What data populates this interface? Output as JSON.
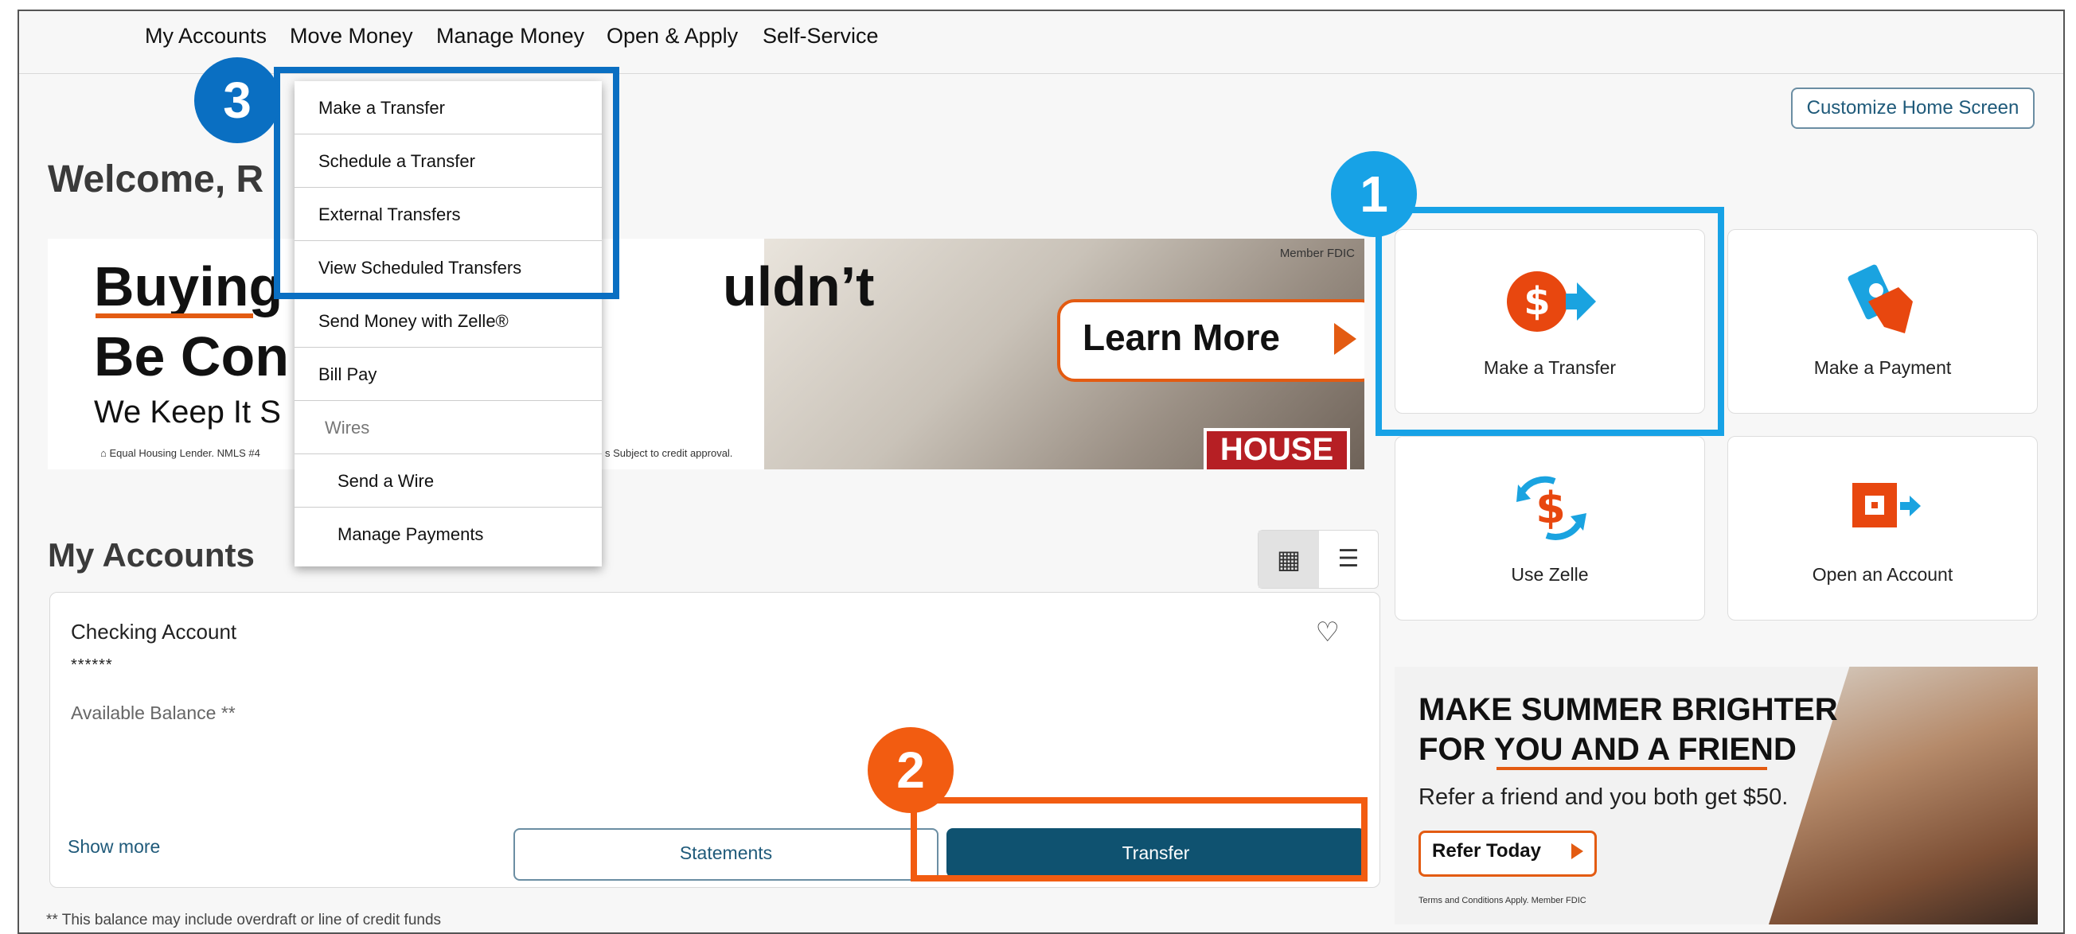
{
  "nav": {
    "items": [
      "My Accounts",
      "Move Money",
      "Manage Money",
      "Open & Apply",
      "Self-Service"
    ]
  },
  "header": {
    "customize_label": "Customize Home Screen",
    "welcome": "Welcome, R"
  },
  "banner": {
    "line1_left": "Buying",
    "line1_right": "uldn’t",
    "line2": "Be Con",
    "sub": "We Keep It S",
    "fine_left": "Equal Housing Lender. NMLS #4",
    "fine_right": "s Subject to credit approval.",
    "member_fdic": "Member FDIC",
    "cta": "Learn More",
    "sign": "HOUSE"
  },
  "dropdown": {
    "items": [
      "Make a Transfer",
      "Schedule a Transfer",
      "External Transfers",
      "View Scheduled Transfers",
      "Send Money with Zelle®",
      "Bill Pay",
      "Wires",
      "Send a Wire",
      "Manage Payments"
    ]
  },
  "accounts": {
    "heading": "My Accounts",
    "card": {
      "name": "Checking Account",
      "mask": "******",
      "balance_label": "Available Balance **",
      "show_more": "Show more",
      "statements": "Statements",
      "transfer": "Transfer"
    },
    "footnote": "** This balance may include overdraft or line of credit funds"
  },
  "tiles": [
    {
      "label": "Make a Transfer",
      "icon": "dollar-arrow-icon"
    },
    {
      "label": "Make a Payment",
      "icon": "hand-money-icon"
    },
    {
      "label": "Use Zelle",
      "icon": "zelle-dollar-icon"
    },
    {
      "label": "Open an Account",
      "icon": "open-account-icon"
    }
  ],
  "promo": {
    "line1": "MAKE SUMMER BRIGHTER",
    "line2": "FOR YOU AND A FRIEND",
    "sub": "Refer a friend and you both get $50.",
    "cta": "Refer Today",
    "fine": "Terms and Conditions Apply. Member FDIC"
  },
  "callouts": {
    "one": "1",
    "two": "2",
    "three": "3"
  },
  "colors": {
    "brand_teal": "#0f5270",
    "accent_orange": "#e35b12",
    "callout_blue": "#17a2e6",
    "callout_dark_blue": "#0a6fc2",
    "callout_orange": "#f25c11"
  }
}
